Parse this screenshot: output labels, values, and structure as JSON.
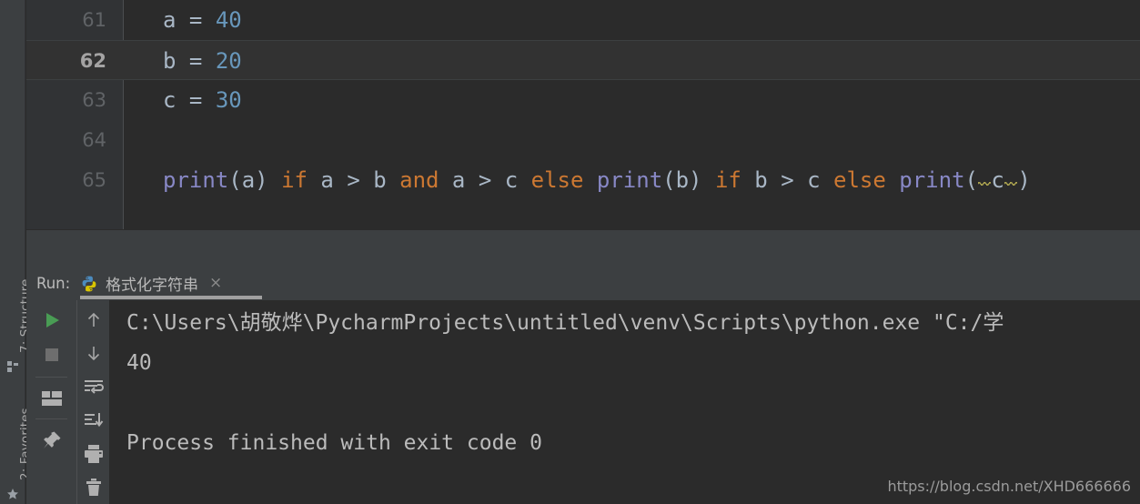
{
  "window": {
    "theme_bg": "#2b2b2b",
    "panel_bg": "#3c3f41",
    "accent_run": "#499c54"
  },
  "left_strip": {
    "items": [
      {
        "label_prefix": "7",
        "label": ": Structure",
        "icon": "structure-icon"
      },
      {
        "label_prefix": "2",
        "label": ": Favorites",
        "icon": "star-icon"
      }
    ]
  },
  "editor": {
    "lines": [
      {
        "number": "61",
        "current": false,
        "tokens": [
          {
            "text": "a",
            "kind": "ident"
          },
          {
            "text": " = ",
            "kind": "op"
          },
          {
            "text": "40",
            "kind": "num"
          }
        ]
      },
      {
        "number": "62",
        "current": true,
        "tokens": [
          {
            "text": "b",
            "kind": "ident"
          },
          {
            "text": " = ",
            "kind": "op"
          },
          {
            "text": "20",
            "kind": "num"
          }
        ]
      },
      {
        "number": "63",
        "current": false,
        "tokens": [
          {
            "text": "c",
            "kind": "ident"
          },
          {
            "text": " = ",
            "kind": "op"
          },
          {
            "text": "30",
            "kind": "num"
          }
        ]
      },
      {
        "number": "64",
        "current": false,
        "tokens": []
      },
      {
        "number": "65",
        "current": false,
        "tokens": [
          {
            "text": "print",
            "kind": "func"
          },
          {
            "text": "(",
            "kind": "paren"
          },
          {
            "text": "a",
            "kind": "ident"
          },
          {
            "text": ") ",
            "kind": "paren"
          },
          {
            "text": "if",
            "kind": "kw"
          },
          {
            "text": " a > b ",
            "kind": "ident"
          },
          {
            "text": "and",
            "kind": "kw"
          },
          {
            "text": " a > c ",
            "kind": "ident"
          },
          {
            "text": "else",
            "kind": "kw"
          },
          {
            "text": " ",
            "kind": "ident"
          },
          {
            "text": "print",
            "kind": "func"
          },
          {
            "text": "(",
            "kind": "paren"
          },
          {
            "text": "b",
            "kind": "ident"
          },
          {
            "text": ") ",
            "kind": "paren"
          },
          {
            "text": "if",
            "kind": "kw"
          },
          {
            "text": " b > c ",
            "kind": "ident"
          },
          {
            "text": "else",
            "kind": "kw"
          },
          {
            "text": " ",
            "kind": "ident"
          },
          {
            "text": "print",
            "kind": "func"
          },
          {
            "text": "(",
            "kind": "paren"
          },
          {
            "text": " ",
            "kind": "warn"
          },
          {
            "text": "c",
            "kind": "ident"
          },
          {
            "text": " ",
            "kind": "warn"
          },
          {
            "text": ")",
            "kind": "paren"
          }
        ]
      }
    ],
    "colors": {
      "identifier": "#a9b7c6",
      "number": "#6897bb",
      "keyword": "#cc7832",
      "function": "#8888c6",
      "warning_squiggle": "#a9a14f",
      "gutter_number": "#606366",
      "current_line_number": "#a4a3a3"
    }
  },
  "run_panel": {
    "label": "Run:",
    "tab": {
      "icon": "python-icon",
      "title": "格式化字符串",
      "close_label": "×"
    },
    "toolbar_primary": [
      {
        "name": "rerun-button",
        "icon": "play-icon"
      },
      {
        "name": "stop-button",
        "icon": "stop-icon"
      },
      {
        "name": "layout-button",
        "icon": "layout-icon"
      },
      {
        "name": "pin-tab-button",
        "icon": "pin-icon"
      }
    ],
    "toolbar_secondary": [
      {
        "name": "up-the-stack-trace-button",
        "icon": "arrow-up-icon"
      },
      {
        "name": "down-the-stack-trace-button",
        "icon": "arrow-down-icon"
      },
      {
        "name": "soft-wrap-button",
        "icon": "soft-wrap-icon"
      },
      {
        "name": "scroll-to-end-button",
        "icon": "scroll-to-end-icon"
      },
      {
        "name": "print-button",
        "icon": "printer-icon"
      },
      {
        "name": "clear-all-button",
        "icon": "trash-icon"
      }
    ],
    "console": {
      "lines": [
        "C:\\Users\\胡敬烨\\PycharmProjects\\untitled\\venv\\Scripts\\python.exe \"C:/学",
        "40",
        "",
        "Process finished with exit code 0"
      ]
    }
  },
  "watermark": {
    "text": "https://blog.csdn.net/XHD666666"
  }
}
